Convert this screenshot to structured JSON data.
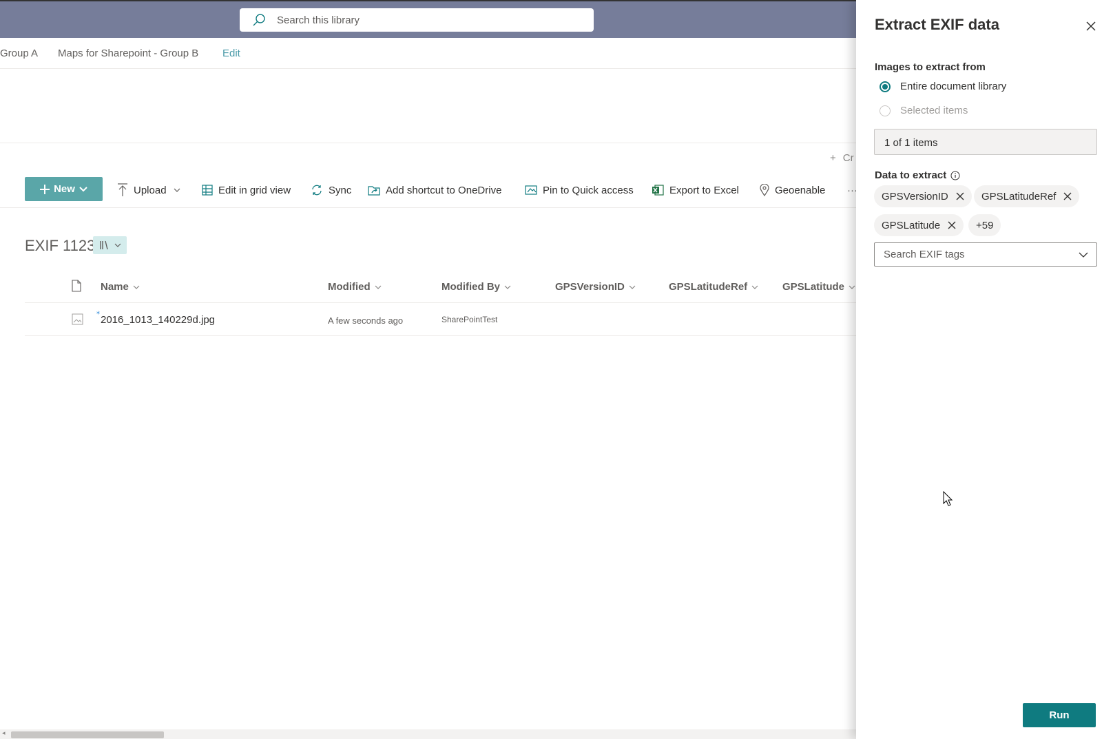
{
  "search": {
    "placeholder": "Search this library"
  },
  "site_nav": {
    "items": [
      "Group A",
      "Maps for Sharepoint - Group B"
    ],
    "edit_label": "Edit"
  },
  "create_hint": "Cr",
  "command_bar": {
    "new_label": "New",
    "upload_label": "Upload",
    "edit_grid_label": "Edit in grid view",
    "sync_label": "Sync",
    "shortcut_label": "Add shortcut to OneDrive",
    "pin_label": "Pin to Quick access",
    "export_label": "Export to Excel",
    "geoenable_label": "Geoenable",
    "more_label": "···"
  },
  "library": {
    "title": "EXIF 1123",
    "columns": [
      "Name",
      "Modified",
      "Modified By",
      "GPSVersionID",
      "GPSLatitudeRef",
      "GPSLatitude"
    ],
    "rows": [
      {
        "name": "2016_1013_140229d.jpg",
        "modified": "A few seconds ago",
        "modified_by": "SharePointTest"
      }
    ]
  },
  "panel": {
    "title": "Extract EXIF data",
    "images_label": "Images to extract from",
    "option_entire": "Entire document library",
    "option_selected": "Selected items",
    "selected_option": "Entire document library",
    "count_text": "1 of 1 items",
    "data_label": "Data to extract",
    "chips": [
      "GPSVersionID",
      "GPSLatitudeRef",
      "GPSLatitude"
    ],
    "more_chip": "+59",
    "search_placeholder": "Search EXIF tags",
    "run_label": "Run"
  },
  "colors": {
    "accent": "#0f7b80",
    "topbar": "#767d9a",
    "new_button": "#5aa6a8"
  }
}
